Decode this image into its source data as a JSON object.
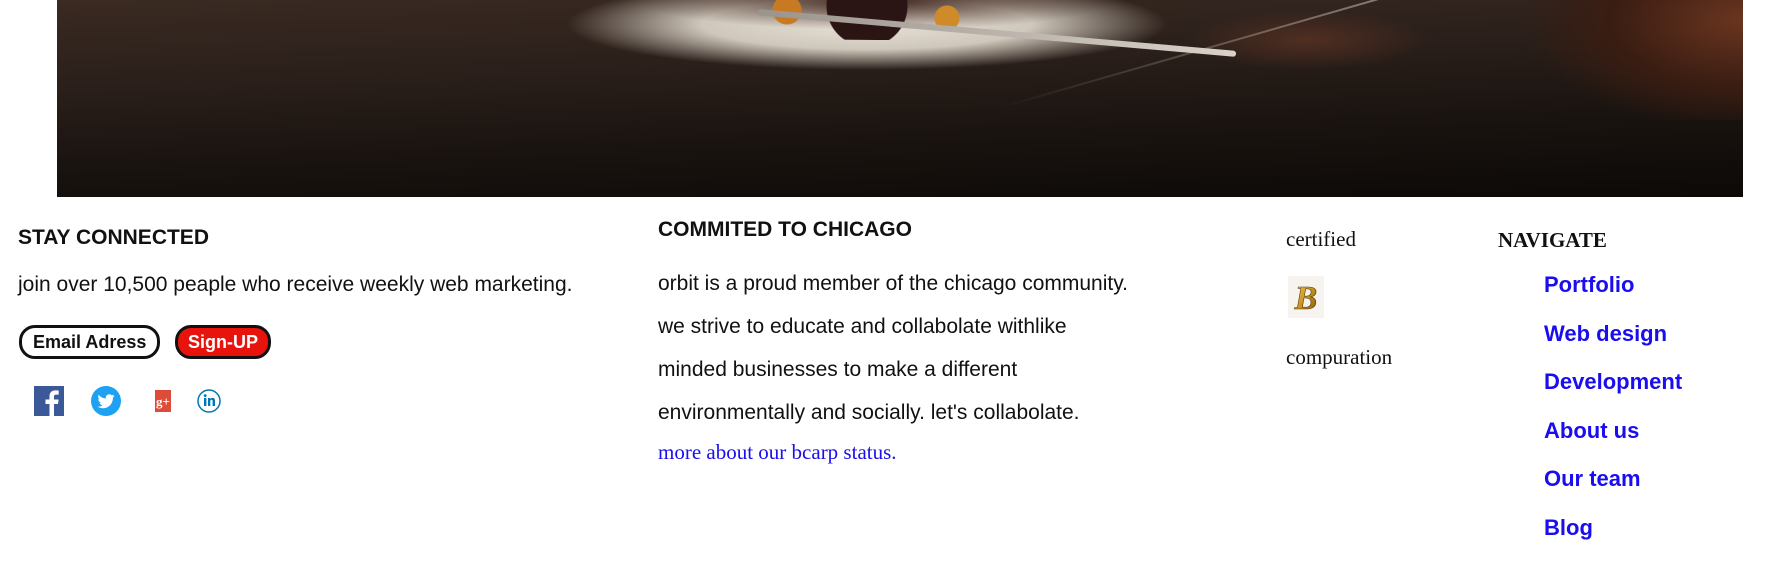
{
  "hero": {
    "image_name": "restaurant-plate-photo"
  },
  "stay_connected": {
    "title": "STAY CONNECTED",
    "text": "join over 10,500 peaple who receive weekly web marketing.",
    "email_label": "Email Adress",
    "signup_label": "Sign-UP",
    "social_icons": [
      "facebook-icon",
      "twitter-icon",
      "google-plus-icon",
      "linkedin-icon"
    ],
    "colors": {
      "signup_bg": "#e8130d",
      "facebook": "#3b5998",
      "twitter": "#1da1f2",
      "google_plus": "#dd4b39",
      "linkedin": "#0077b5"
    }
  },
  "committed": {
    "title": "COMMITED TO CHICAGO",
    "lines": [
      "orbit is a proud member of the chicago community.",
      "we strive to educate and collabolate withlike",
      "minded businesses to make a different",
      "environmentally and socially. let's collabolate."
    ],
    "link": "more about our bcarp status."
  },
  "certified": {
    "top": "certified",
    "logo_icon": "b-corp-logo-icon",
    "bottom": "compuration"
  },
  "navigate": {
    "title": "NAVIGATE",
    "items": [
      "Portfolio",
      "Web design",
      "Development",
      "About us",
      "Our team",
      "Blog"
    ],
    "link_color": "#1a0dee"
  }
}
